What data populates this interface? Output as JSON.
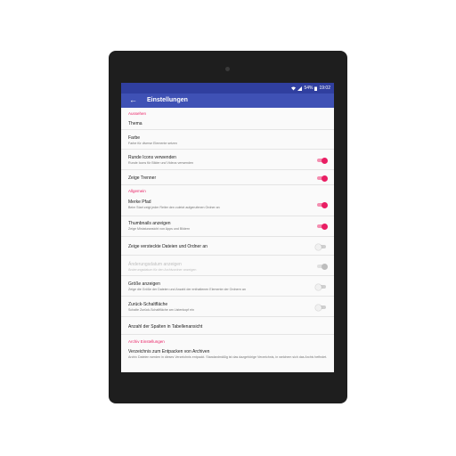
{
  "status_bar": {
    "battery": "54%",
    "time": "19:02"
  },
  "toolbar": {
    "title": "Einstellungen",
    "back_icon": "arrow-back-icon"
  },
  "sections": {
    "appearance": "Aussehen",
    "general": "Allgemein",
    "archive": "Archiv Einstellungen"
  },
  "items": {
    "theme": {
      "title": "Thema"
    },
    "color": {
      "title": "Farbe",
      "summary": "Farbe für diverse Elemente setzen"
    },
    "round_icons": {
      "title": "Runde Icons verwenden",
      "summary": "Runde Icons für Bilder und Videos verwenden",
      "checked": true
    },
    "dividers": {
      "title": "Zeige Trenner",
      "checked": true
    },
    "remember_path": {
      "title": "Merke Pfad",
      "summary": "Beim Start zeigt jeder Reiter den zuletzt aufgerufenen Ordner an",
      "checked": true
    },
    "thumbnails": {
      "title": "Thumbnails anzeigen",
      "summary": "Zeige Miniaturansicht von Apps und Bildern",
      "checked": true
    },
    "hidden": {
      "title": "Zeige versteckte Dateien und Ordner an",
      "checked": false
    },
    "change_date": {
      "title": "Änderungsdatum anzeigen",
      "summary": "Änderungsdatum für den Archivordner anzeigen",
      "checked": true,
      "enabled": false
    },
    "show_size": {
      "title": "Größe anzeigen",
      "summary": "Zeige die Größe der Dateien und Anzahl der enthaltenen Elemente der Ordnern an",
      "checked": false
    },
    "back_button": {
      "title": "Zurück-Schaltfläche",
      "summary": "Schalte Zurück-Schaltfläche am Listenkopf ein",
      "checked": false
    },
    "columns": {
      "title": "Anzahl der Spalten in Tabellenansicht"
    },
    "extract_dir": {
      "title": "Verzeichnis zum Entpacken von Archiven",
      "summary": "Archiv Dateien werden in dieses Verzeichnis entpackt. Standardmäßig ist das dazgehörige Verzeichnis, in welchem sich das Archiv befindet."
    }
  },
  "colors": {
    "accent": "#e91e63",
    "primary": "#3f51b5",
    "primary_dark": "#303f9f"
  }
}
